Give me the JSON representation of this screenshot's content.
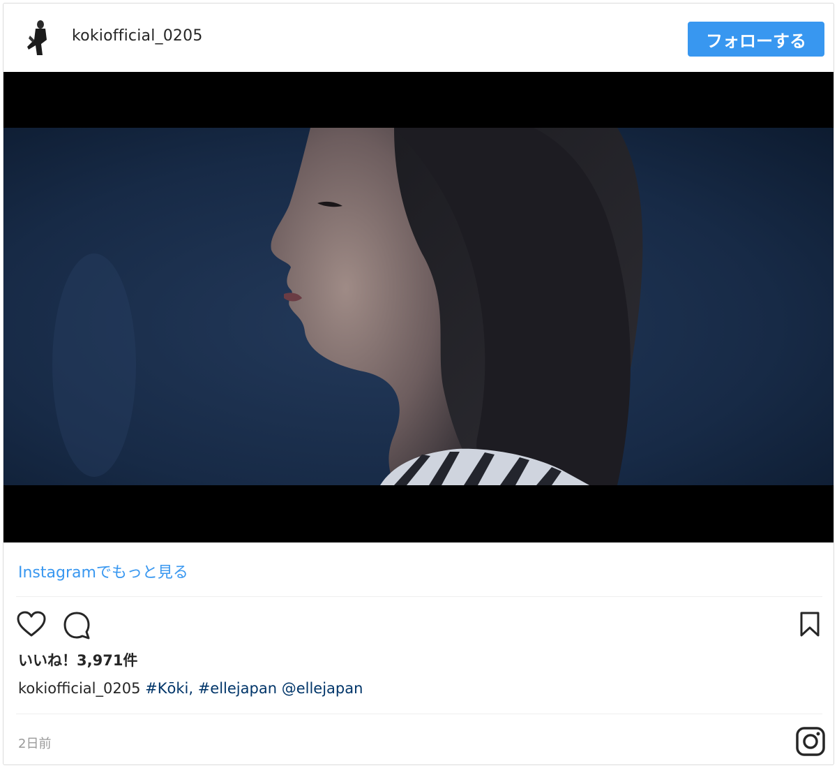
{
  "header": {
    "username": "kokiofficial_0205",
    "follow_label": "フォローする"
  },
  "media": {
    "icon": "video-frame-profile-portrait"
  },
  "more_link": "Instagramでもっと見る",
  "actions": {
    "like_icon": "heart-icon",
    "comment_icon": "comment-icon",
    "save_icon": "bookmark-icon"
  },
  "likes_label": "いいね！3,971件",
  "caption": {
    "username": "kokiofficial_0205",
    "tag1": "#Kōki,",
    "tag2": "#ellejapan",
    "mention": "@ellejapan"
  },
  "timestamp": "2日前",
  "colors": {
    "accent": "#3897f0",
    "tag": "#003569"
  }
}
